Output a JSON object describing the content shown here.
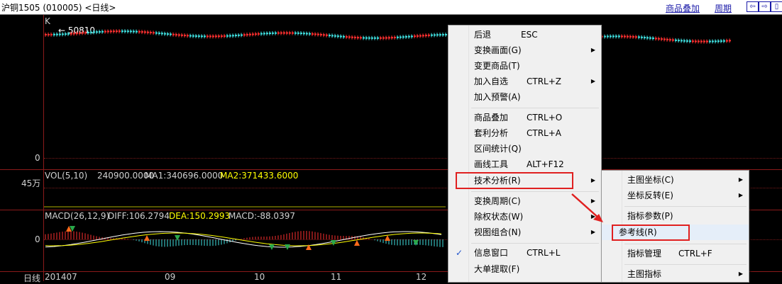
{
  "header": {
    "title": "沪铜1505 (010005) <日线>",
    "links": [
      "商品叠加",
      "周期"
    ],
    "nav_buttons": [
      "⇦",
      "⇨",
      "▯"
    ]
  },
  "main_chart": {
    "k_label": "K",
    "max_label": "← 50810",
    "zero_label": "0"
  },
  "volume": {
    "scale_label": "45万",
    "indicator_name": "VOL(5,10)",
    "vol_value": "240900.0000",
    "ma1": "MA1:340696.0000",
    "ma2": "MA2:371433.6000"
  },
  "macd": {
    "indicator_name": "MACD(26,12,9)",
    "diff": "DIFF:106.2794",
    "dea": "DEA:150.2993",
    "macd": "MACD:-88.0397",
    "zero_label": "0"
  },
  "x_axis": {
    "period_label": "日线",
    "ticks": [
      "201407",
      "09",
      "10",
      "11",
      "12"
    ]
  },
  "context_menu": {
    "items": [
      {
        "label": "后退",
        "shortcut": "ESC"
      },
      {
        "label": "变换画面(G)",
        "submenu": true
      },
      {
        "label": "变更商品(T)"
      },
      {
        "label": "加入自选",
        "shortcut": "CTRL+Z",
        "submenu": true
      },
      {
        "label": "加入预警(A)"
      },
      {
        "label": "商品叠加",
        "shortcut": "CTRL+O"
      },
      {
        "label": "套利分析",
        "shortcut": "CTRL+A"
      },
      {
        "label": "区间统计(Q)"
      },
      {
        "label": "画线工具",
        "shortcut": "ALT+F12"
      },
      {
        "label": "技术分析(R)",
        "submenu": true,
        "highlighted": true
      },
      {
        "label": "变换周期(C)",
        "submenu": true
      },
      {
        "label": "除权状态(W)",
        "submenu": true
      },
      {
        "label": "视图组合(N)",
        "submenu": true
      },
      {
        "label": "信息窗口",
        "shortcut": "CTRL+L",
        "checked": true
      },
      {
        "label": "大单提取(F)"
      }
    ]
  },
  "submenu": {
    "items": [
      {
        "label": "主图坐标(C)",
        "submenu": true
      },
      {
        "label": "坐标反转(E)",
        "submenu": true
      },
      {
        "label": "指标参数(P)"
      },
      {
        "label": "参考线(R)",
        "highlighted": true
      },
      {
        "label": "指标管理",
        "shortcut": "CTRL+F"
      },
      {
        "label": "主图指标",
        "submenu": true
      }
    ]
  },
  "colors": {
    "up": "#ff3030",
    "down": "#40e0e0",
    "diff_line": "#ffffff",
    "dea_line": "#ffff00",
    "frame": "#8b1a1a",
    "highlight_box": "#e02020"
  }
}
